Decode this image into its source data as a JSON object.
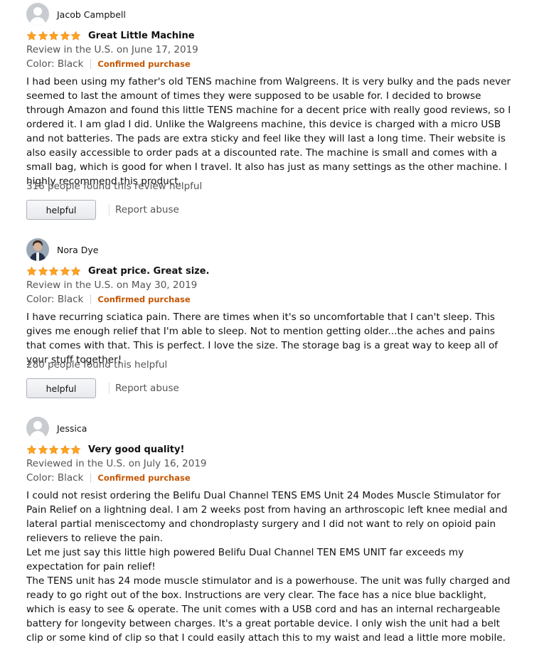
{
  "colors": {
    "star": "#ffa41c",
    "badge": "#c45500",
    "muted": "#555555"
  },
  "reviews": [
    {
      "reviewer": "Jacob Campbell",
      "avatar": "person-icon",
      "rating": 5,
      "title": "Great Little Machine",
      "date": "Review in the U.S. on June 17, 2019",
      "color": "Color: Black",
      "badge": "Confirmed purchase",
      "text": "I had been using my father's old TENS machine from Walgreens. It is very bulky and the pads never seemed to last the amount of times they were supposed to be usable for. I decided to browse through Amazon and found this little TENS machine for a decent price with really good reviews, so I ordered it. I am glad I did. Unlike the Walgreens machine, this device is charged with a micro USB and not batteries. The pads are extra sticky and feel like they will last a long time. Their website is also easily accessible to order pads at a discounted rate. The machine is small and comes with a small bag, which is good for when I travel. It also has just as many settings as the other machine. I highly recommend this product.",
      "helpful_count": "316 people found this review helpful",
      "helpful_label": "helpful",
      "report_label": "Report abuse"
    },
    {
      "reviewer": "Nora Dye",
      "avatar": "profile-photo",
      "rating": 5,
      "title": "Great price. Great size.",
      "date": "Review in the U.S. on May 30, 2019",
      "color": "Color: Black",
      "badge": "Confirmed purchase",
      "text": "I have recurring sciatica pain. There are times when it's so uncomfortable that I can't sleep. This gives me enough relief that I'm able to sleep. Not to mention getting older...the aches and pains that comes with that. This is perfect. I love the size. The storage bag is a great way to keep all of your stuff together!",
      "helpful_count": "280 people found this helpful",
      "helpful_label": "helpful",
      "report_label": "Report abuse"
    },
    {
      "reviewer": "Jessica",
      "avatar": "person-icon",
      "rating": 5,
      "title": "Very good quality!",
      "date": "Reviewed in the U.S. on July 16, 2019",
      "color": "Color: Black",
      "badge": "Confirmed purchase",
      "text": "I could not resist ordering the Belifu Dual Channel TENS EMS Unit 24 Modes Muscle Stimulator for Pain Relief on a lightning deal. I am 2 weeks post from having an arthroscopic left knee medial and lateral partial meniscectomy and chondroplasty surgery and I did not want to rely on opioid pain relievers to relieve the pain.\nLet me just say this little high powered Belifu Dual Channel TEN EMS UNIT far exceeds my expectation for pain relief!\nThe TENS unit has 24 mode muscle stimulator and is a powerhouse. The unit was fully charged and ready to go right out of the box. Instructions are very clear. The face has a nice blue backlight, which is easy to see & operate. The unit comes with a USB cord and has an internal rechargeable battery for longevity between charges. It's a great portable device. I only wish the unit had a belt clip or some kind of clip so that I could easily attach this to my waist and lead a little more mobile."
    }
  ]
}
